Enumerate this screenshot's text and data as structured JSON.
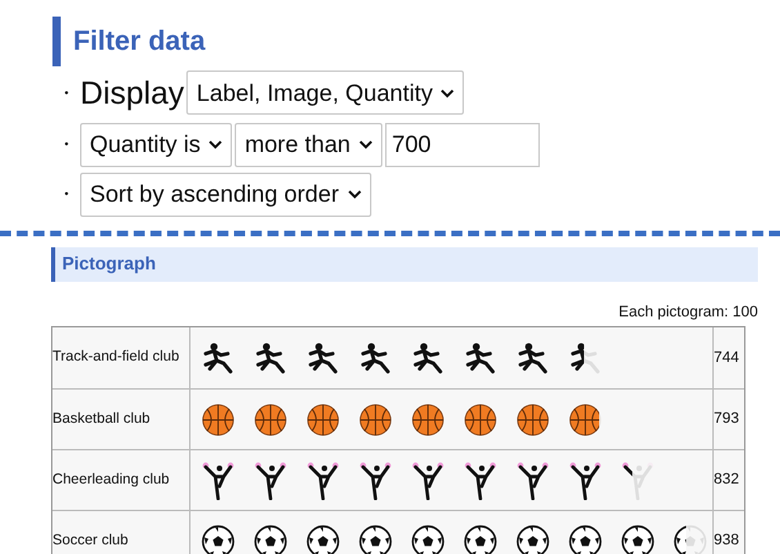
{
  "filter": {
    "title": "Filter data",
    "lines": [
      {
        "bullet": "・",
        "label": "Display",
        "controls": [
          {
            "kind": "select",
            "value": "Label, Image, Quantity"
          }
        ]
      },
      {
        "bullet": "・",
        "controls": [
          {
            "kind": "select",
            "value": "Quantity is"
          },
          {
            "kind": "select",
            "value": "more than"
          },
          {
            "kind": "input",
            "value": "700"
          }
        ]
      },
      {
        "bullet": "・",
        "controls": [
          {
            "kind": "select",
            "value": "Sort by ascending order"
          }
        ]
      }
    ]
  },
  "pictograph": {
    "title": "Pictograph",
    "unit_note": "Each pictogram: 100",
    "rows": [
      {
        "label": "Track-and-field club",
        "kind": "runner",
        "quantity": "744"
      },
      {
        "label": "Basketball club",
        "kind": "basketball",
        "quantity": "793"
      },
      {
        "label": "Cheerleading club",
        "kind": "cheerleader",
        "quantity": "832"
      },
      {
        "label": "Soccer club",
        "kind": "soccer",
        "quantity": "938"
      }
    ]
  }
}
